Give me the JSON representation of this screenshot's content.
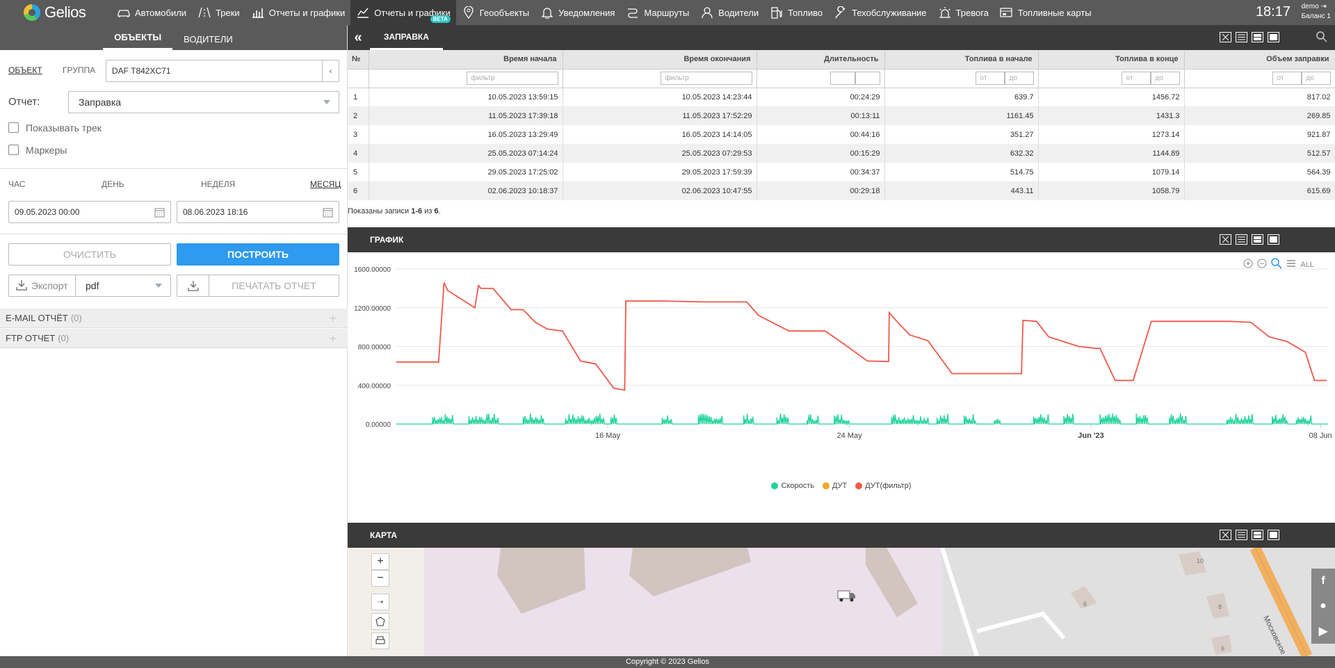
{
  "brand": "Gelios",
  "nav": [
    {
      "label": "Автомобили",
      "icon": "car-icon"
    },
    {
      "label": "Треки",
      "icon": "road-icon"
    },
    {
      "label": "Отчеты и графики",
      "icon": "bar-chart-icon"
    },
    {
      "label": "Отчеты и графики",
      "icon": "line-chart-icon",
      "badge": "BETA"
    },
    {
      "label": "Геообъекты",
      "icon": "location-pin-icon"
    },
    {
      "label": "Уведомления",
      "icon": "bell-icon"
    },
    {
      "label": "Маршруты",
      "icon": "route-icon"
    },
    {
      "label": "Водители",
      "icon": "driver-icon"
    },
    {
      "label": "Топливо",
      "icon": "fuel-pump-icon"
    },
    {
      "label": "Техобслуживание",
      "icon": "wrench-icon"
    },
    {
      "label": "Тревога",
      "icon": "alarm-icon"
    },
    {
      "label": "Топливные карты",
      "icon": "fuel-card-icon"
    }
  ],
  "clock": "18:17",
  "user": {
    "name": "demo",
    "balance": "Баланс 1"
  },
  "left": {
    "tabs": [
      "ОБЪЕКТЫ",
      "ВОДИТЕЛИ"
    ],
    "object_modes": [
      "ОБЪЕКТ",
      "ГРУППА"
    ],
    "object_value": "DAF T842XC71",
    "report_label": "Отчет:",
    "report_value": "Заправка",
    "show_track": "Показывать трек",
    "markers": "Маркеры",
    "periods": [
      "ЧАС",
      "ДЕНЬ",
      "НЕДЕЛЯ",
      "МЕСЯЦ"
    ],
    "date_from": "09.05.2023 00:00",
    "date_to": "08.06.2023 18:16",
    "clear": "ОЧИСТИТЬ",
    "build": "ПОСТРОИТЬ",
    "export": "Экспорт",
    "export_format": "pdf",
    "print": "ПЕЧАТАТЬ ОТЧЕТ",
    "email": {
      "label": "E-MAIL ОТЧЁТ",
      "count": "(0)"
    },
    "ftp": {
      "label": "FTP ОТЧЕТ",
      "count": "(0)"
    }
  },
  "table_panel": {
    "title": "ЗАПРАВКА",
    "columns": [
      "№",
      "Время начала",
      "Время окончания",
      "Длительность",
      "Топлива в начале",
      "Топлива в конце",
      "Объем заправки"
    ],
    "filter_placeholder": "фильтр",
    "from_placeholder": "от",
    "to_placeholder": "до",
    "rows": [
      [
        "1",
        "10.05.2023 13:59:15",
        "10.05.2023 14:23:44",
        "00:24:29",
        "639.7",
        "1456.72",
        "817.02"
      ],
      [
        "2",
        "11.05.2023 17:39:18",
        "11.05.2023 17:52:29",
        "00:13:11",
        "1161.45",
        "1431.3",
        "269.85"
      ],
      [
        "3",
        "16.05.2023 13:29:49",
        "16.05.2023 14:14:05",
        "00:44:16",
        "351.27",
        "1273.14",
        "921.87"
      ],
      [
        "4",
        "25.05.2023 07:14:24",
        "25.05.2023 07:29:53",
        "00:15:29",
        "632.32",
        "1144.89",
        "512.57"
      ],
      [
        "5",
        "29.05.2023 17:25:02",
        "29.05.2023 17:59:39",
        "00:34:37",
        "514.75",
        "1079.14",
        "564.39"
      ],
      [
        "6",
        "02.06.2023 10:18:37",
        "02.06.2023 10:47:55",
        "00:29:18",
        "443.11",
        "1058.79",
        "615.69"
      ]
    ],
    "summary_prefix": "Показаны записи ",
    "summary_range": "1-6",
    "summary_mid": " из ",
    "summary_total": "6",
    "summary_end": "."
  },
  "chart_panel": {
    "title": "ГРАФИК",
    "all_label": "ALL"
  },
  "chart_data": {
    "type": "line",
    "title": "",
    "ylim": [
      0,
      1600
    ],
    "yticks": [
      "1600.00000",
      "1200.00000",
      "800.00000",
      "400.00000",
      "0.00000"
    ],
    "xticks": [
      "16 May",
      "24 May",
      "Jun '23",
      "08 Jun"
    ],
    "colors": {
      "speed": "#1fd39a",
      "dut": "#f5a623",
      "dut_filter": "#f0584a"
    },
    "series": [
      {
        "name": "Скорость",
        "color": "#1fd39a"
      },
      {
        "name": "ДУТ",
        "color": "#f5a623"
      },
      {
        "name": "ДУТ(фильтр)",
        "color": "#f0584a",
        "x": [
          9.0,
          10.4,
          10.58,
          10.7,
          11.6,
          11.72,
          11.8,
          12.2,
          12.8,
          13.2,
          13.6,
          14.0,
          14.5,
          15.1,
          15.6,
          16.2,
          16.56,
          16.6,
          17.8,
          19.2,
          20.6,
          21.0,
          22.0,
          22.6,
          23.2,
          23.8,
          24.6,
          25.3,
          25.32,
          25.6,
          26.0,
          26.6,
          27.4,
          28.0,
          29.0,
          29.7,
          29.75,
          30.2,
          30.6,
          31.6,
          32.2,
          32.3,
          32.8,
          33.4,
          34.0,
          35.5,
          36.6,
          37.3,
          37.9,
          38.5,
          39.1,
          39.4,
          39.8
        ],
        "y": [
          640,
          640,
          1460,
          1380,
          1200,
          1430,
          1400,
          1400,
          1180,
          1180,
          1050,
          980,
          960,
          650,
          620,
          370,
          350,
          1270,
          1270,
          1260,
          1260,
          1120,
          960,
          960,
          960,
          830,
          650,
          645,
          1150,
          1050,
          920,
          860,
          520,
          520,
          520,
          520,
          1070,
          1060,
          900,
          800,
          780,
          780,
          450,
          450,
          1060,
          1060,
          1060,
          1050,
          900,
          850,
          740,
          450,
          450
        ]
      }
    ]
  },
  "map_panel": {
    "title": "КАРТА",
    "buildings": [
      "10",
      "8",
      "6",
      "6"
    ],
    "street": "Московское"
  },
  "copyright": "Copyright © 2023 Gelios"
}
